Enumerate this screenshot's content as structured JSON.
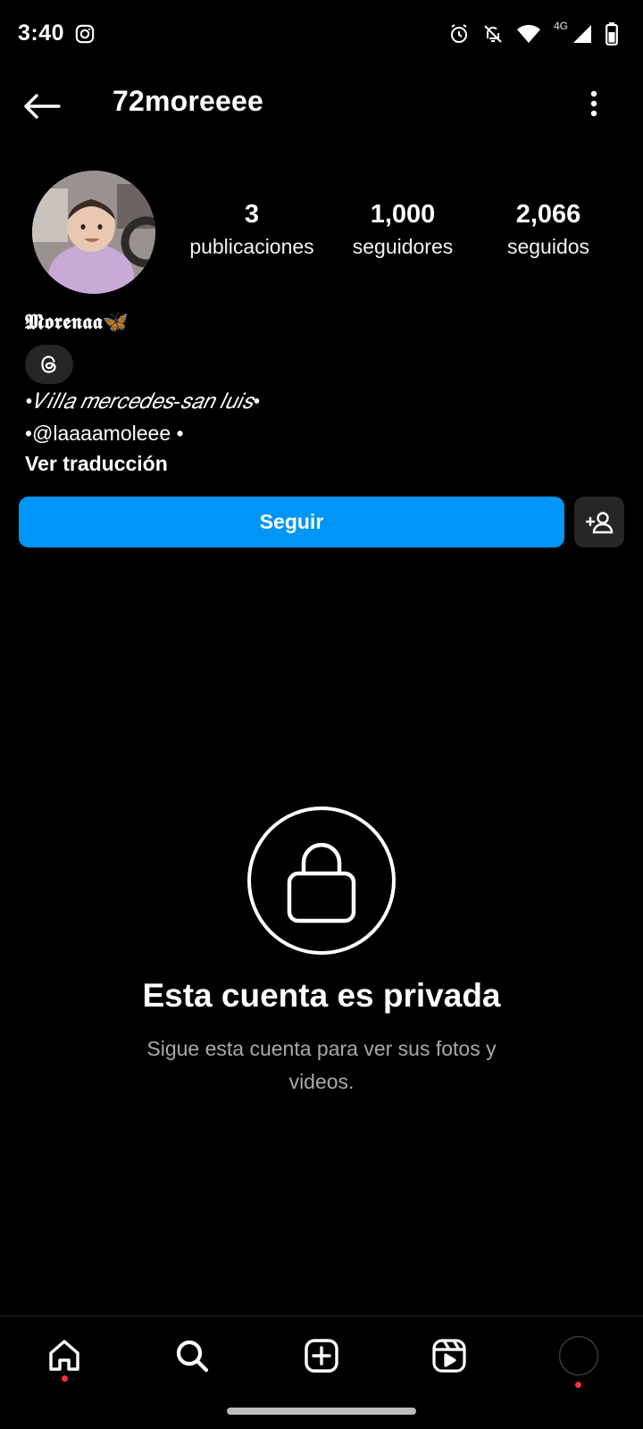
{
  "status_bar": {
    "time": "3:40",
    "network": "4G",
    "icons": [
      "instagram-icon",
      "alarm-icon",
      "notifications-off-icon",
      "wifi-icon",
      "signal-icon",
      "battery-icon"
    ]
  },
  "header": {
    "username": "72moreeee",
    "back_icon": "arrow-left-icon",
    "menu_icon": "more-vertical-icon"
  },
  "profile": {
    "stats": [
      {
        "value": "3",
        "label": "publicaciones"
      },
      {
        "value": "1,000",
        "label": "seguidores"
      },
      {
        "value": "2,066",
        "label": "seguidos"
      }
    ],
    "display_name": "𝕸𝖔𝖗𝖊𝖓𝖆𝖆🦋",
    "bio_line_1": "•𝑉𝑖𝑙𝑙𝑎 𝑚𝑒𝑟𝑐𝑒𝑑𝑒𝑠-𝑠𝑎𝑛 𝑙𝑢𝑖𝑠•",
    "bio_line_2": "•@laaaamoleee •",
    "translate_label": "Ver traducción"
  },
  "actions": {
    "follow_label": "Seguir",
    "suggest_icon": "add-person-icon"
  },
  "private": {
    "title": "Esta cuenta es privada",
    "subtitle": "Sigue esta cuenta para ver sus fotos y videos."
  },
  "bottom_nav": {
    "items": [
      "home-icon",
      "search-icon",
      "create-icon",
      "reels-icon",
      "profile-avatar"
    ]
  },
  "colors": {
    "background": "#000000",
    "accent": "#0095f6",
    "secondary_button": "#262626",
    "muted_text": "#a8a8a8",
    "notification_dot": "#ff3040"
  }
}
